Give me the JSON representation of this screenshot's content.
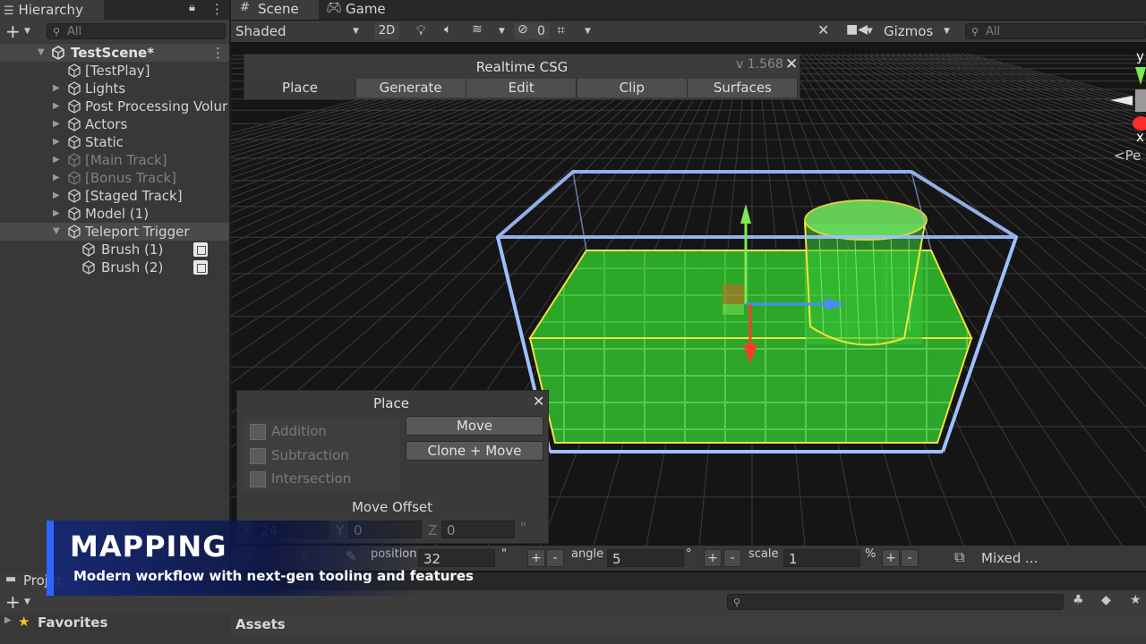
{
  "hierarchy": {
    "tab_label": "Hierarchy",
    "search_placeholder": "All",
    "scene_name": "TestScene*",
    "items": [
      {
        "label": "[TestPlay]",
        "dim": false
      },
      {
        "label": "Lights",
        "dim": false
      },
      {
        "label": "Post Processing Volur",
        "dim": false
      },
      {
        "label": "Actors",
        "dim": false
      },
      {
        "label": "Static",
        "dim": false
      },
      {
        "label": "[Main Track]",
        "dim": true
      },
      {
        "label": "[Bonus Track]",
        "dim": true
      },
      {
        "label": "[Staged Track]",
        "dim": false
      },
      {
        "label": "Model (1)",
        "dim": false
      },
      {
        "label": "Teleport Trigger",
        "dim": false
      }
    ],
    "children": [
      {
        "label": "Brush (1)"
      },
      {
        "label": "Brush (2)"
      }
    ]
  },
  "scene_tabs": {
    "scene": "Scene",
    "game": "Game"
  },
  "scene_toolbar": {
    "shading_mode": "Shaded",
    "mode_2d": "2D",
    "hidden_count": "0",
    "gizmos": "Gizmos",
    "search_placeholder": "All"
  },
  "gizmo": {
    "y_label": "y",
    "x_label": "x",
    "projection": "<Pe"
  },
  "csg_window": {
    "title": "Realtime CSG",
    "version": "v 1.568",
    "tabs": [
      "Place",
      "Generate",
      "Edit",
      "Clip",
      "Surfaces"
    ],
    "active_tab": "Place"
  },
  "place_window": {
    "title": "Place",
    "operations": [
      "Addition",
      "Subtraction",
      "Intersection"
    ],
    "move_button": "Move",
    "clone_move_button": "Clone + Move",
    "move_offset_label": "Move Offset",
    "offset": {
      "x_label": "X",
      "x": "24",
      "y_label": "Y",
      "y": "0",
      "z_label": "Z",
      "z": "0",
      "unit": "\""
    }
  },
  "snap_bar": {
    "axes": [
      "X",
      "Y",
      "Z"
    ],
    "position_label": "position",
    "position_value": "32",
    "position_unit": "\"",
    "angle_label": "angle",
    "angle_value": "5",
    "angle_unit": "°",
    "scale_label": "scale",
    "scale_value": "1",
    "scale_unit": "%",
    "plus": "+",
    "minus": "-",
    "mixed_label": "Mixed ..."
  },
  "project": {
    "tab_label": "Projec",
    "favorites": "Favorites",
    "assets": "Assets"
  },
  "banner": {
    "title": "MAPPING",
    "subtitle": "Modern workflow with next-gen tooling and features"
  },
  "colors": {
    "accent_blue": "#2f64ff",
    "brush_green": "#35c832",
    "bounds_blue": "#9fc0ff",
    "edge_yellow": "#f3e33a"
  }
}
